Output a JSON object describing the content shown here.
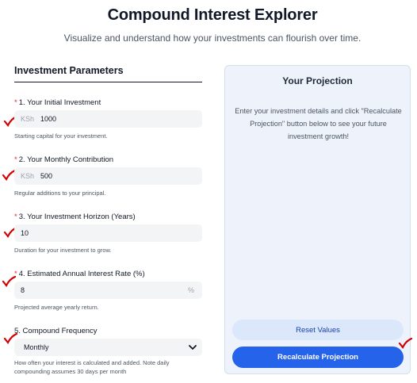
{
  "header": {
    "title": "Compound Interest Explorer",
    "subtitle": "Visualize and understand how your investments can flourish over time."
  },
  "params": {
    "heading": "Investment Parameters",
    "fields": [
      {
        "required": "*",
        "label": "1. Your Initial Investment",
        "prefix": "KSh",
        "value": "1000",
        "help": "Starting capital for your investment."
      },
      {
        "required": "*",
        "label": "2. Your Monthly Contribution",
        "prefix": "KSh",
        "value": "500",
        "help": "Regular additions to your principal."
      },
      {
        "required": "*",
        "label": "3. Your Investment Horizon (Years)",
        "value": "10",
        "help": "Duration for your investment to grow."
      },
      {
        "required": "*",
        "label": "4. Estimated Annual Interest Rate (%)",
        "value": "8",
        "suffix": "%",
        "help": "Projected average yearly return."
      },
      {
        "label": "5. Compound Frequency",
        "value": "Monthly",
        "help": "How often your interest is calculated and added. Note daily compounding assumes 30 days per month"
      }
    ]
  },
  "projection": {
    "title": "Your Projection",
    "message": "Enter your investment details and click \"Recalculate Projection\" button below to see your future investment growth!",
    "reset_label": "Reset Values",
    "recalc_label": "Recalculate Projection"
  },
  "colors": {
    "accent": "#2563eb",
    "required": "#dc2626",
    "annotation": "#d40000"
  },
  "icons": [
    "checkmark-annotation-icon",
    "chevron-down-icon"
  ]
}
